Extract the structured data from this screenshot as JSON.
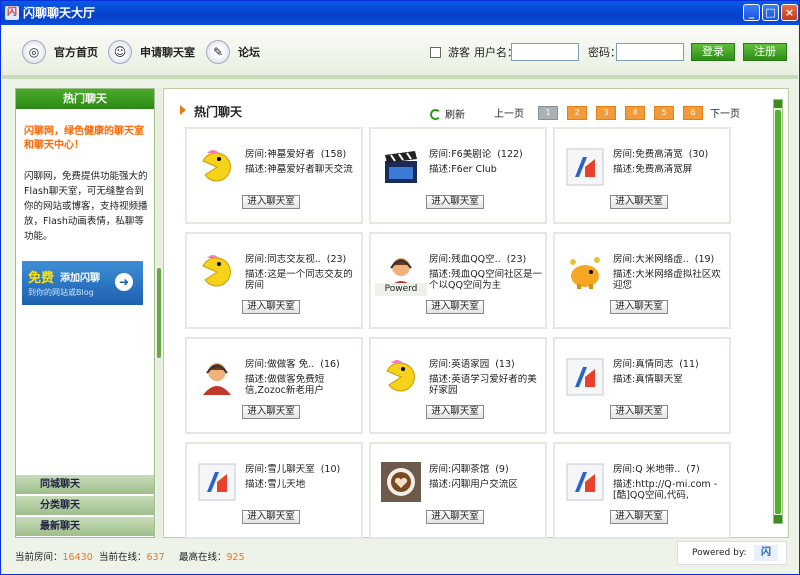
{
  "window": {
    "title": "闪聊聊天大厅",
    "minimize": "_",
    "maximize": "□",
    "close": "×"
  },
  "nav": {
    "home": "官方首页",
    "apply": "申请聊天室",
    "forum": "论坛"
  },
  "login": {
    "guest": "游客",
    "username_label": "用户名：",
    "username_value": "",
    "password_label": "密码：",
    "password_value": "",
    "login_btn": "登录",
    "register_btn": "注册"
  },
  "sidebar": {
    "header": "热门聊天",
    "slogan": "闪聊网，绿色健康的聊天室和聊天中心！",
    "desc": "闪聊网，免费提供功能强大的Flash聊天室，可无缝整合到你的网站或博客，支持视频播放，Flash动画表情，私聊等功能。",
    "banner": {
      "free": "免费",
      "add": "添加闪聊",
      "sub": "到你的网站或Blog"
    },
    "items": [
      "同城聊天",
      "分类聊天",
      "最新聊天"
    ]
  },
  "main": {
    "title": "热门聊天",
    "refresh": "刷新",
    "pager": {
      "prev": "上一页",
      "next": "下一页",
      "pages": [
        "1",
        "2",
        "3",
        "4",
        "5",
        "6"
      ],
      "current": "1"
    },
    "room_label": "房间:",
    "desc_label": "描述:",
    "enter_label": "进入聊天室",
    "rooms": [
      {
        "name": "神墓爱好者",
        "count": "(158)",
        "desc": "神墓爱好者聊天交流",
        "icon": "pacman-icon"
      },
      {
        "name": "F6美剧论",
        "count": "(122)",
        "desc": "F6er Club",
        "icon": "clapperboard-icon"
      },
      {
        "name": "免费高清宽",
        "count": "(30)",
        "desc": "免费高清宽屏",
        "icon": "shanliao-logo-icon"
      },
      {
        "name": "同志交友视..",
        "count": "(23)",
        "desc": "这是一个同志交友的房间",
        "icon": "pacman-icon"
      },
      {
        "name": "残血QQ空..",
        "count": "(23)",
        "desc": "残血QQ空间社区是一个以QQ空间为主",
        "icon": "headset-avatar-icon",
        "overlay": "Powerd"
      },
      {
        "name": "大米网络虚..",
        "count": "(19)",
        "desc": "大米网络虚拟社区欢迎您",
        "icon": "piggybank-icon"
      },
      {
        "name": "做做客 免..",
        "count": "(16)",
        "desc": "做做客免费短信,Zozoc新老用户",
        "icon": "headset-avatar-icon"
      },
      {
        "name": "英语家园",
        "count": "(13)",
        "desc": "英语学习爱好者的美好家园",
        "icon": "pacman-icon"
      },
      {
        "name": "真情同志",
        "count": "(11)",
        "desc": "真情聊天室",
        "icon": "shanliao-logo-icon"
      },
      {
        "name": "雪儿聊天室",
        "count": "(10)",
        "desc": "雪儿天地",
        "icon": "shanliao-logo-icon"
      },
      {
        "name": "闪聊茶馆",
        "count": "(9)",
        "desc": "闪聊用户交流区",
        "icon": "coffee-cup-icon"
      },
      {
        "name": "Q 米地带..",
        "count": "(7)",
        "desc": "http://Q-mi.com - [酷]QQ空间,代码,",
        "icon": "shanliao-logo-icon"
      }
    ]
  },
  "status": {
    "current_rooms_label": "当前房间：",
    "current_rooms": "16430",
    "online_label": "当前在线：",
    "online": "637",
    "max_label": "最高在线：",
    "max": "925",
    "powered": "Powered by:"
  },
  "colors": {
    "title_blue": "#0a5ae6",
    "green": "#2f8c17",
    "orange": "#f29b3a"
  }
}
